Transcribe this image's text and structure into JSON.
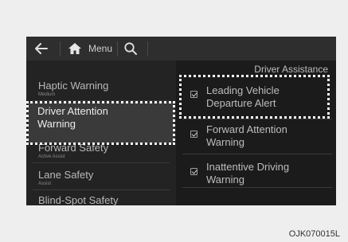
{
  "topbar": {
    "back_icon": "back-arrow-icon",
    "home_icon": "home-icon",
    "menu_label": "Menu",
    "search_icon": "search-icon"
  },
  "left_menu": [
    {
      "title": "Haptic Warning",
      "subtitle": "Medium"
    },
    {
      "title": "Driver Attention Warning",
      "subtitle": ""
    },
    {
      "title": "Forward Safety",
      "subtitle": "Active Assist"
    },
    {
      "title": "Lane Safety",
      "subtitle": "Assist"
    },
    {
      "title": "Blind-Spot Safety",
      "subtitle": ""
    }
  ],
  "selected_title_line1": "Driver Attention",
  "selected_title_line2": "Warning",
  "section_title": "Driver Assistance",
  "options": [
    {
      "line1": "Leading Vehicle",
      "line2": "Departure Alert",
      "checked": true
    },
    {
      "line1": "Forward Attention",
      "line2": "Warning",
      "checked": true
    },
    {
      "line1": "Inattentive Driving",
      "line2": "Warning",
      "checked": true
    }
  ],
  "caption": "OJK070015L",
  "colors": {
    "highlight_outline": "#ffffff",
    "screen_bg": "#1b1b1b"
  }
}
